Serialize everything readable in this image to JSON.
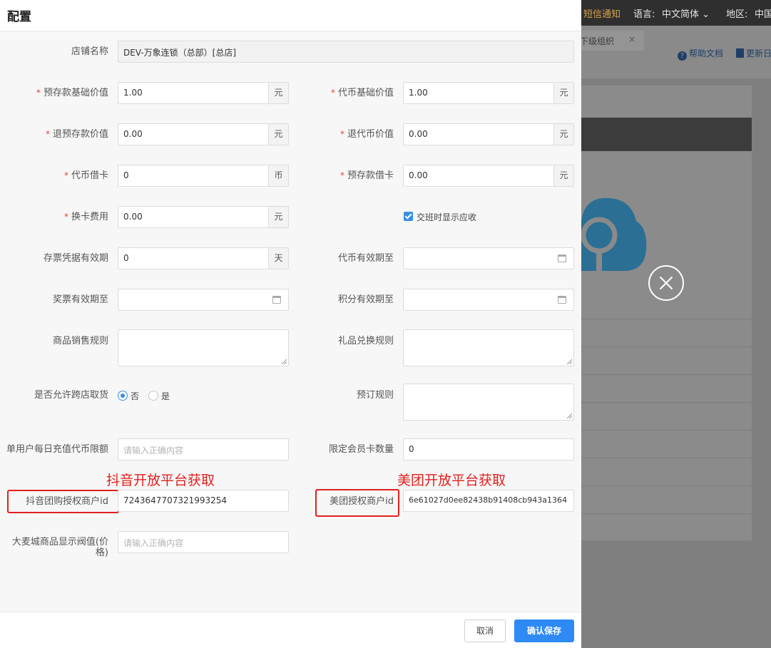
{
  "background": {
    "topbar": {
      "sms": "短信通知",
      "language": "语言:",
      "language_value": "中文简体",
      "region": "地区:",
      "region_value": "中国"
    },
    "tab_label": "下级组织",
    "help_label": "帮助文档",
    "update_label": "更新日"
  },
  "modal": {
    "title": "配置",
    "fields": {
      "store_name": {
        "label": "店铺名称",
        "value": "DEV-万象连锁（总部）[总店]"
      },
      "prepay_base_value": {
        "label": "预存款基础价值",
        "value": "1.00",
        "unit": "元"
      },
      "token_base_value": {
        "label": "代币基础价值",
        "value": "1.00",
        "unit": "元"
      },
      "refund_prepay_value": {
        "label": "退预存款价值",
        "value": "0.00",
        "unit": "元"
      },
      "refund_token_value": {
        "label": "退代币价值",
        "value": "0.00",
        "unit": "元"
      },
      "token_card": {
        "label": "代币借卡",
        "value": "0",
        "unit": "币"
      },
      "prepay_card": {
        "label": "预存款借卡",
        "value": "0.00",
        "unit": "元"
      },
      "card_change_fee": {
        "label": "换卡费用",
        "value": "0.00",
        "unit": "元"
      },
      "show_receivable": {
        "label": "交班时显示应收",
        "checked": true
      },
      "ticket_validity": {
        "label": "存票凭据有效期",
        "value": "0",
        "unit": "天"
      },
      "token_valid_until": {
        "label": "代币有效期至",
        "value": ""
      },
      "prize_valid_until": {
        "label": "奖票有效期至",
        "value": ""
      },
      "points_valid_until": {
        "label": "积分有效期至",
        "value": ""
      },
      "sales_rules": {
        "label": "商品销售规则",
        "value": ""
      },
      "gift_rules": {
        "label": "礼品兑换规则",
        "value": ""
      },
      "cross_store": {
        "label": "是否允许跨店取货",
        "options": [
          "否",
          "是"
        ],
        "selected": "否"
      },
      "booking_rules": {
        "label": "预订规则",
        "value": ""
      },
      "daily_recharge_limit": {
        "label": "单用户每日充值代币限额",
        "placeholder": "请输入正确内容"
      },
      "member_card_limit": {
        "label": "限定会员卡数量",
        "value": "0"
      },
      "douyin_merchant_id": {
        "label": "抖音团购授权商户id",
        "value": "7243647707321993254"
      },
      "meituan_merchant_id": {
        "label": "美团授权商户id",
        "value": "6e61027d0ee82438b91408cb943a1364"
      },
      "damai_price_threshold": {
        "label": "大麦城商品显示阀值(价格)",
        "placeholder": "请输入正确内容"
      }
    },
    "annotations": {
      "douyin": "抖音开放平台获取",
      "meituan": "美团开放平台获取"
    },
    "footer": {
      "cancel": "取消",
      "save": "确认保存"
    }
  },
  "colors": {
    "primary": "#2f8af5",
    "required": "#e0453a",
    "annotation": "#e02020"
  }
}
